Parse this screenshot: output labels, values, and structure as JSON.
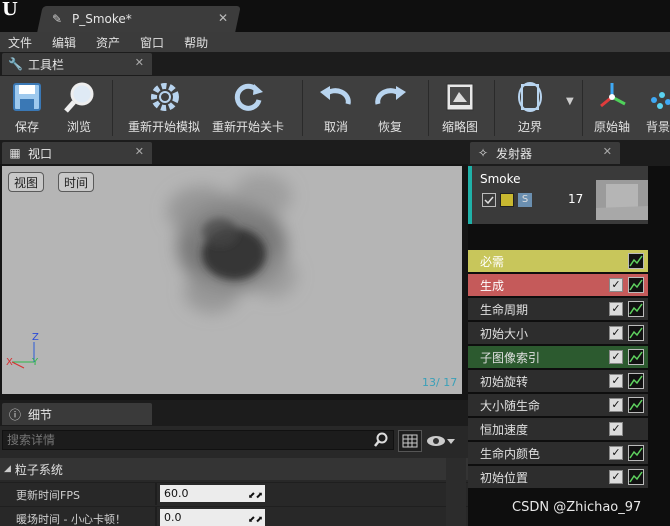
{
  "window": {
    "tab_title": "P_Smoke*"
  },
  "menu": [
    "文件",
    "编辑",
    "资产",
    "窗口",
    "帮助"
  ],
  "toolbar": {
    "tab_label": "工具栏",
    "buttons": [
      {
        "label": "保存",
        "icon": "save-icon"
      },
      {
        "label": "浏览",
        "icon": "browse-icon"
      },
      {
        "label": "重新开始模拟",
        "icon": "restart-sim-icon"
      },
      {
        "label": "重新开始关卡",
        "icon": "restart-level-icon"
      },
      {
        "label": "取消",
        "icon": "undo-icon"
      },
      {
        "label": "恢复",
        "icon": "redo-icon"
      },
      {
        "label": "缩略图",
        "icon": "thumbnail-icon"
      },
      {
        "label": "边界",
        "icon": "bounds-icon"
      },
      {
        "label": "原始轴",
        "icon": "origin-axis-icon"
      },
      {
        "label": "背景",
        "icon": "background-icon"
      }
    ]
  },
  "viewport": {
    "tab_label": "视口",
    "view_button": "视图",
    "time_button": "时间",
    "axis_z": "Z",
    "axis_y": "Y",
    "axis_x": "X",
    "frame_counter": "13/  17"
  },
  "details": {
    "tab_label": "细节",
    "search_placeholder": "搜索详情",
    "category": "粒子系统",
    "properties": [
      {
        "name": "更新时间FPS",
        "value": "60.0"
      },
      {
        "name": "暖场时间 - 小心卡顿！",
        "value": "0.0"
      }
    ]
  },
  "emitters": {
    "tab_label": "发射器",
    "emitter_name": "Smoke",
    "emitter_count": "17",
    "modules": [
      {
        "label": "必需",
        "bg": "#c8c65b",
        "fg": "#ffffff",
        "check": false
      },
      {
        "label": "生成",
        "bg": "#c55a5a",
        "fg": "#ffffff",
        "check": true
      },
      {
        "label": "生命周期",
        "bg": "#2d2d2d",
        "fg": "#e0e0e0",
        "check": true
      },
      {
        "label": "初始大小",
        "bg": "#2d2d2d",
        "fg": "#e0e0e0",
        "check": true
      },
      {
        "label": "子图像索引",
        "bg": "#2c5a2f",
        "fg": "#e0e0e0",
        "check": true
      },
      {
        "label": "初始旋转",
        "bg": "#2d2d2d",
        "fg": "#e0e0e0",
        "check": true
      },
      {
        "label": "大小随生命",
        "bg": "#2d2d2d",
        "fg": "#e0e0e0",
        "check": true
      },
      {
        "label": "恒加速度",
        "bg": "#2d2d2d",
        "fg": "#e0e0e0",
        "check": true,
        "no_graph": true
      },
      {
        "label": "生命内颜色",
        "bg": "#2d2d2d",
        "fg": "#e0e0e0",
        "check": true
      },
      {
        "label": "初始位置",
        "bg": "#2d2d2d",
        "fg": "#e0e0e0",
        "check": true
      }
    ]
  },
  "watermark": "CSDN @Zhichao_97"
}
